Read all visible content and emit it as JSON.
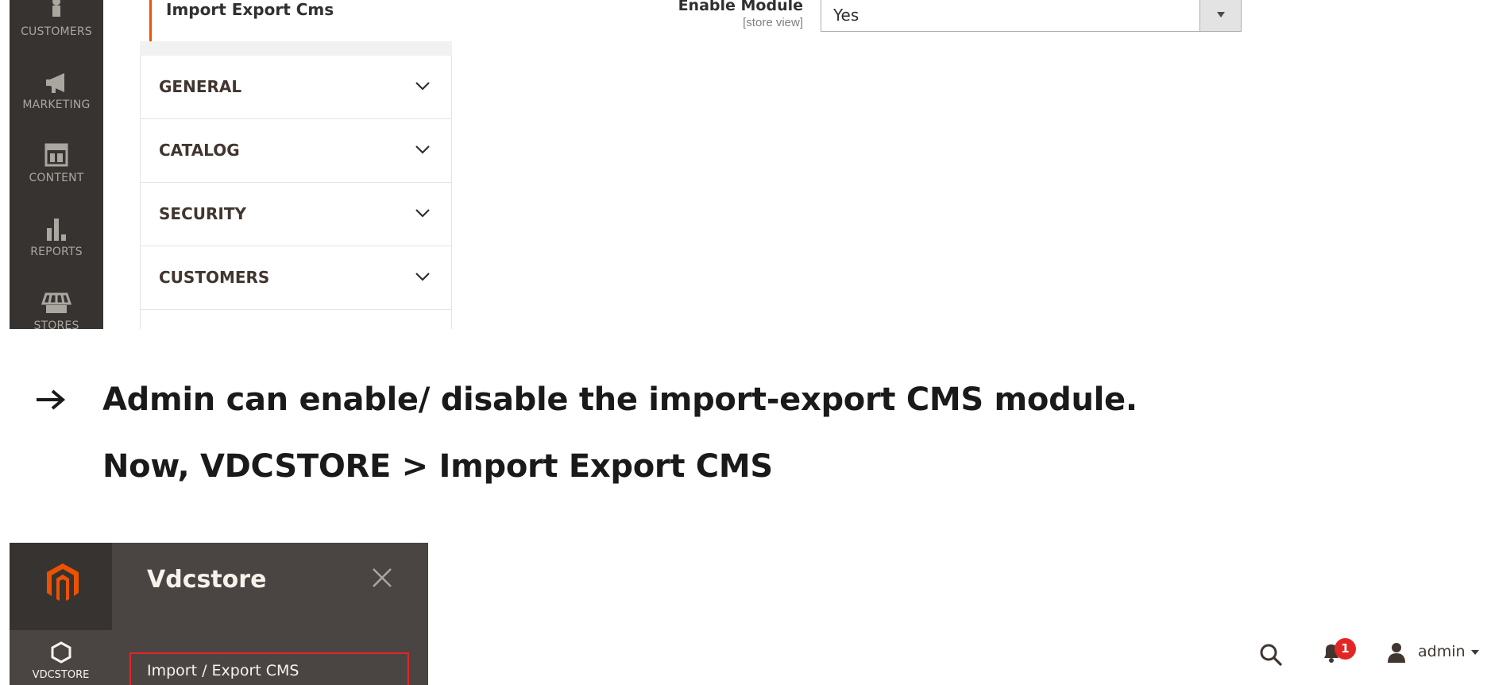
{
  "top_screenshot": {
    "sidebar": {
      "items": [
        {
          "label": "CUSTOMERS",
          "icon": "customers-icon"
        },
        {
          "label": "MARKETING",
          "icon": "megaphone-icon"
        },
        {
          "label": "CONTENT",
          "icon": "content-icon"
        },
        {
          "label": "REPORTS",
          "icon": "bar-chart-icon"
        },
        {
          "label": "STORES",
          "icon": "store-icon"
        }
      ]
    },
    "active_section": "Import Export Cms",
    "tabs": [
      {
        "label": "GENERAL"
      },
      {
        "label": "CATALOG"
      },
      {
        "label": "SECURITY"
      },
      {
        "label": "CUSTOMERS"
      }
    ],
    "field": {
      "label": "Enable Module",
      "scope": "[store view]",
      "value": "Yes"
    },
    "colors": {
      "sidebar": "#373330",
      "accent": "#eb5202"
    }
  },
  "note": {
    "bullet": "→",
    "line1": "Admin can enable/ disable the import-export CMS module.",
    "line2": "Now, VDCSTORE > Import Export CMS"
  },
  "bottom_screenshot": {
    "nav_item": {
      "label": "VDCSTORE",
      "icon": "hexagon-icon"
    },
    "flyout": {
      "title": "Vdcstore",
      "link": "Import / Export CMS"
    },
    "header": {
      "notification_count": "1",
      "user": "admin"
    },
    "colors": {
      "highlight": "#e22626",
      "logo": "#eb5202"
    }
  }
}
